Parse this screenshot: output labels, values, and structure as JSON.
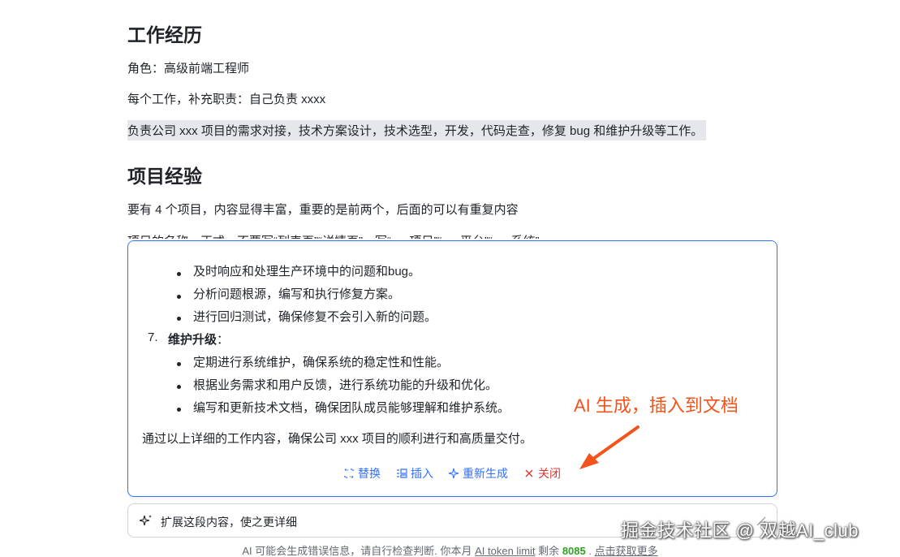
{
  "doc": {
    "section1_title": "工作经历",
    "role_line": "角色：高级前端工程师",
    "duty_line": "每个工作，补充职责：自己负责 xxxx",
    "selected_line": "负责公司 xxx 项目的需求对接，技术方案设计，技术选型，开发，代码走查，修复 bug 和维护升级等工作。",
    "section2_title": "项目经验",
    "projects_line": "要有 4 个项目，内容显得丰富，重要的是前两个，后面的可以有重复内容",
    "clipped_line": "项目的名称，正式，不要写“列表页”“详情页”，写“xxx项目”“xxx平台”“xxx系统”"
  },
  "ai_panel": {
    "bullets_a": [
      "及时响应和处理生产环境中的问题和bug。",
      "分析问题根源，编写和执行修复方案。",
      "进行回归测试，确保修复不会引入新的问题。"
    ],
    "item7_number": "7.",
    "item7_title": "维护升级",
    "item7_colon": "：",
    "bullets_b": [
      "定期进行系统维护，确保系统的稳定性和性能。",
      "根据业务需求和用户反馈，进行系统功能的升级和优化。",
      "编写和更新技术文档，确保团队成员能够理解和维护系统。"
    ],
    "summary": "通过以上详细的工作内容，确保公司 xxx 项目的顺利进行和高质量交付。",
    "actions": {
      "replace": "替换",
      "insert": "插入",
      "regenerate": "重新生成",
      "close": "关闭"
    }
  },
  "annotation": "AI 生成，插入到文档",
  "prompt": {
    "text": "扩展这段内容，使之更详细"
  },
  "watermark": "掘金技术社区 @ 双越AI_club",
  "footer": {
    "prefix": "AI 可能会生成错误信息，请自行检查判断. 你本月",
    "link": "AI token limit",
    "remaining_label": "剩余",
    "remaining_count": "8085",
    "separator": ".",
    "more_link": "点击获取更多"
  },
  "colors": {
    "accent": "#3370ff",
    "danger": "#d83931",
    "annotation": "#f2541b",
    "count": "#2ea121"
  }
}
